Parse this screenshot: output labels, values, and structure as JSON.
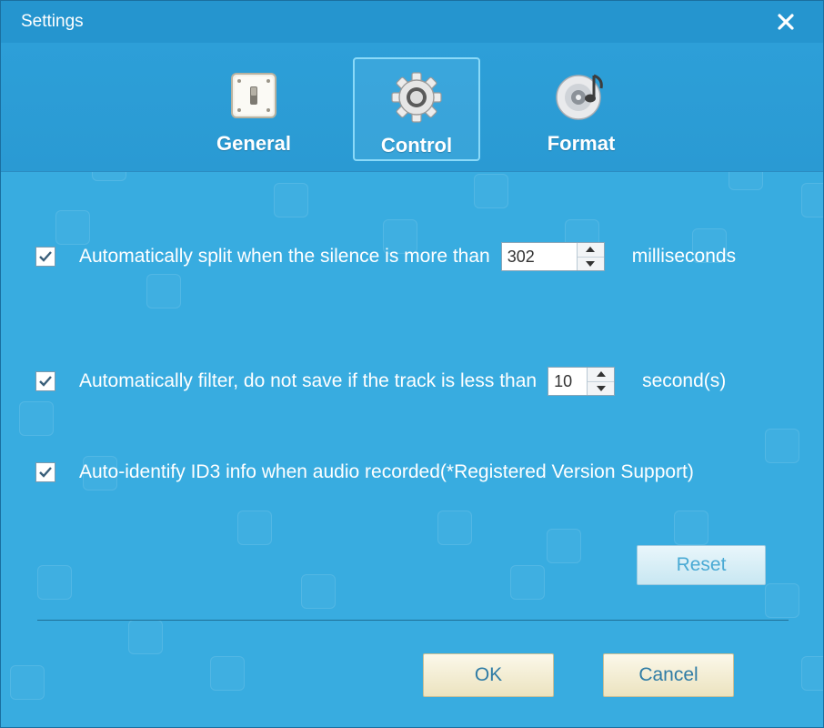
{
  "window": {
    "title": "Settings"
  },
  "tabs": [
    {
      "label": "General",
      "icon": "switch-icon"
    },
    {
      "label": "Control",
      "icon": "gear-icon",
      "active": true
    },
    {
      "label": "Format",
      "icon": "disc-music-icon"
    }
  ],
  "options": {
    "split": {
      "checked": true,
      "label": "Automatically split when the silence is more than",
      "value": "302",
      "unit": "milliseconds"
    },
    "filter": {
      "checked": true,
      "label": "Automatically filter, do not save if the track is less than",
      "value": "10",
      "unit": "second(s)"
    },
    "id3": {
      "checked": true,
      "label": "Auto-identify ID3 info when audio recorded(*Registered Version Support)"
    }
  },
  "buttons": {
    "reset": "Reset",
    "ok": "OK",
    "cancel": "Cancel"
  },
  "colors": {
    "background": "#38ace0",
    "titlebar": "#2595cf",
    "tab_active_border": "#8ad9f8"
  }
}
